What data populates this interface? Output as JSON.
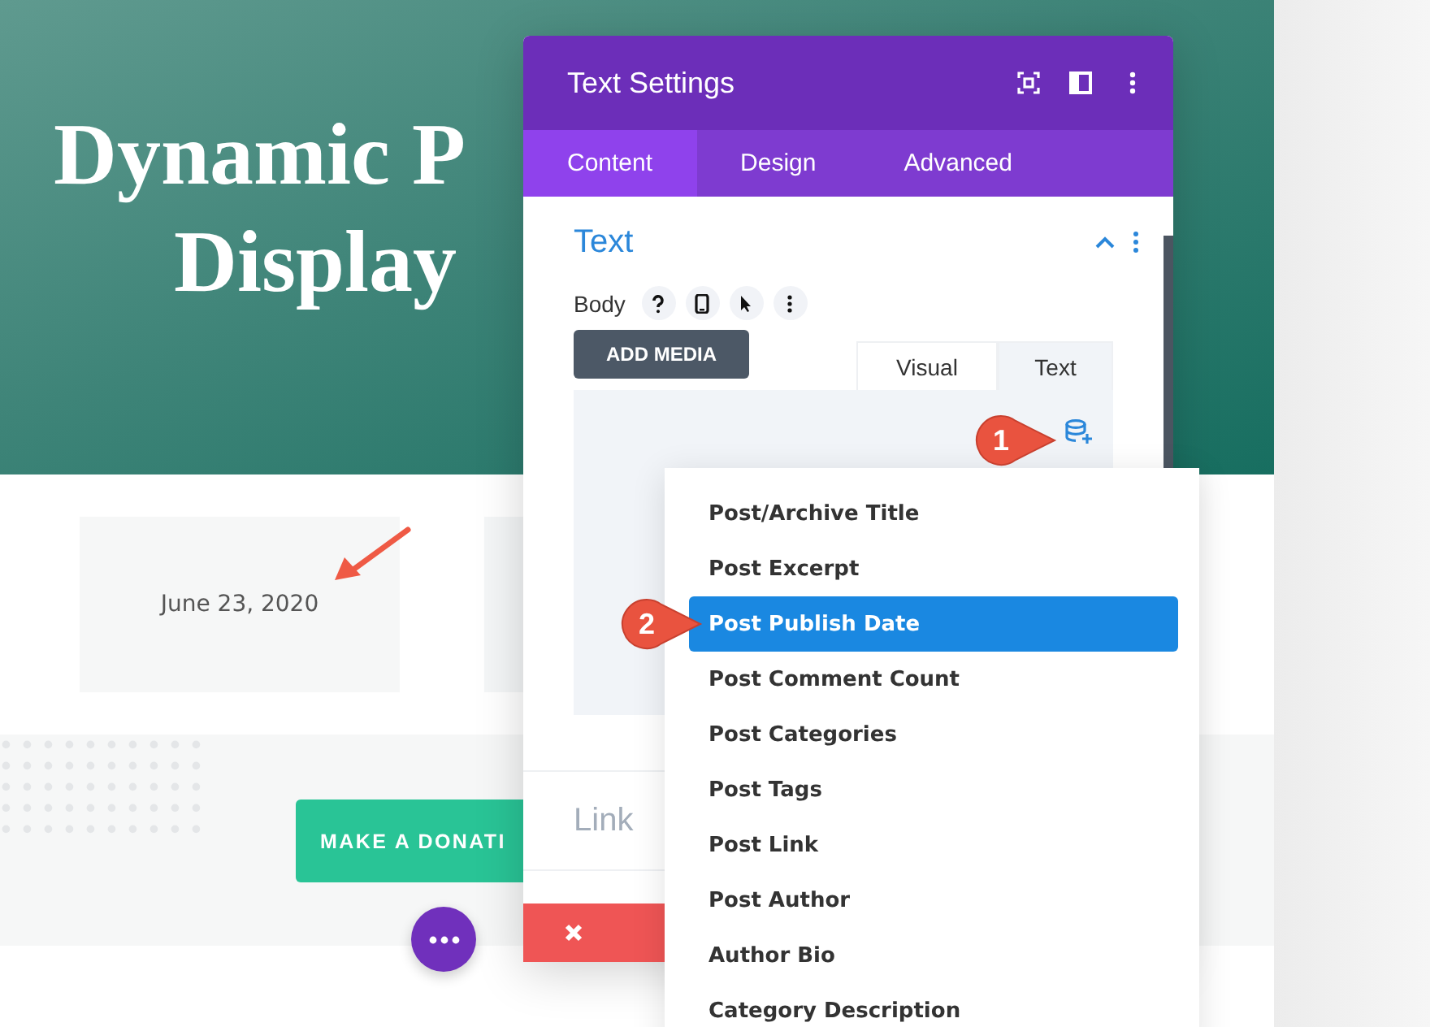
{
  "hero": {
    "title_lines": [
      "Dynamic P",
      "Display"
    ]
  },
  "date_card": {
    "text": "June 23, 2020"
  },
  "donate_button": {
    "label": "MAKE A DONATI"
  },
  "settings_panel": {
    "title": "Text Settings",
    "tabs": [
      {
        "label": "Content",
        "selected": true
      },
      {
        "label": "Design",
        "selected": false
      },
      {
        "label": "Advanced",
        "selected": false
      }
    ],
    "section": {
      "title": "Text",
      "expanded": true
    },
    "body_label": "Body",
    "add_media": "ADD MEDIA",
    "editor_tabs": [
      {
        "label": "Visual",
        "selected": false
      },
      {
        "label": "Text",
        "selected": true
      }
    ],
    "link_section": {
      "title": "Link"
    }
  },
  "dynamic_menu": {
    "items": [
      {
        "label": "Post/Archive Title",
        "selected": false
      },
      {
        "label": "Post Excerpt",
        "selected": false
      },
      {
        "label": "Post Publish Date",
        "selected": true
      },
      {
        "label": "Post Comment Count",
        "selected": false
      },
      {
        "label": "Post Categories",
        "selected": false
      },
      {
        "label": "Post Tags",
        "selected": false
      },
      {
        "label": "Post Link",
        "selected": false
      },
      {
        "label": "Post Author",
        "selected": false
      },
      {
        "label": "Author Bio",
        "selected": false
      },
      {
        "label": "Category Description",
        "selected": false
      }
    ]
  },
  "callouts": [
    "1",
    "2"
  ]
}
